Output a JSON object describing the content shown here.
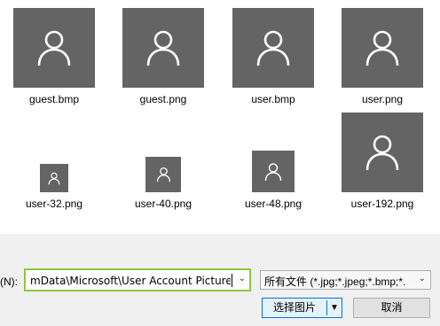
{
  "files": [
    {
      "name": "guest.bmp"
    },
    {
      "name": "guest.png"
    },
    {
      "name": "user.bmp"
    },
    {
      "name": "user.png"
    },
    {
      "name": "user-32.png"
    },
    {
      "name": "user-40.png"
    },
    {
      "name": "user-48.png"
    },
    {
      "name": "user-192.png"
    }
  ],
  "filename": {
    "label": "(N):",
    "value": "mData\\Microsoft\\User Account Pictures"
  },
  "filetype": {
    "selected": "所有文件 (*.jpg;*.jpeg;*.bmp;*."
  },
  "buttons": {
    "open_label": "选择图片",
    "cancel_label": "取消"
  },
  "colors": {
    "thumbnail": "#646464",
    "focus_border": "#8dc63f",
    "primary_border": "#0078d7"
  }
}
